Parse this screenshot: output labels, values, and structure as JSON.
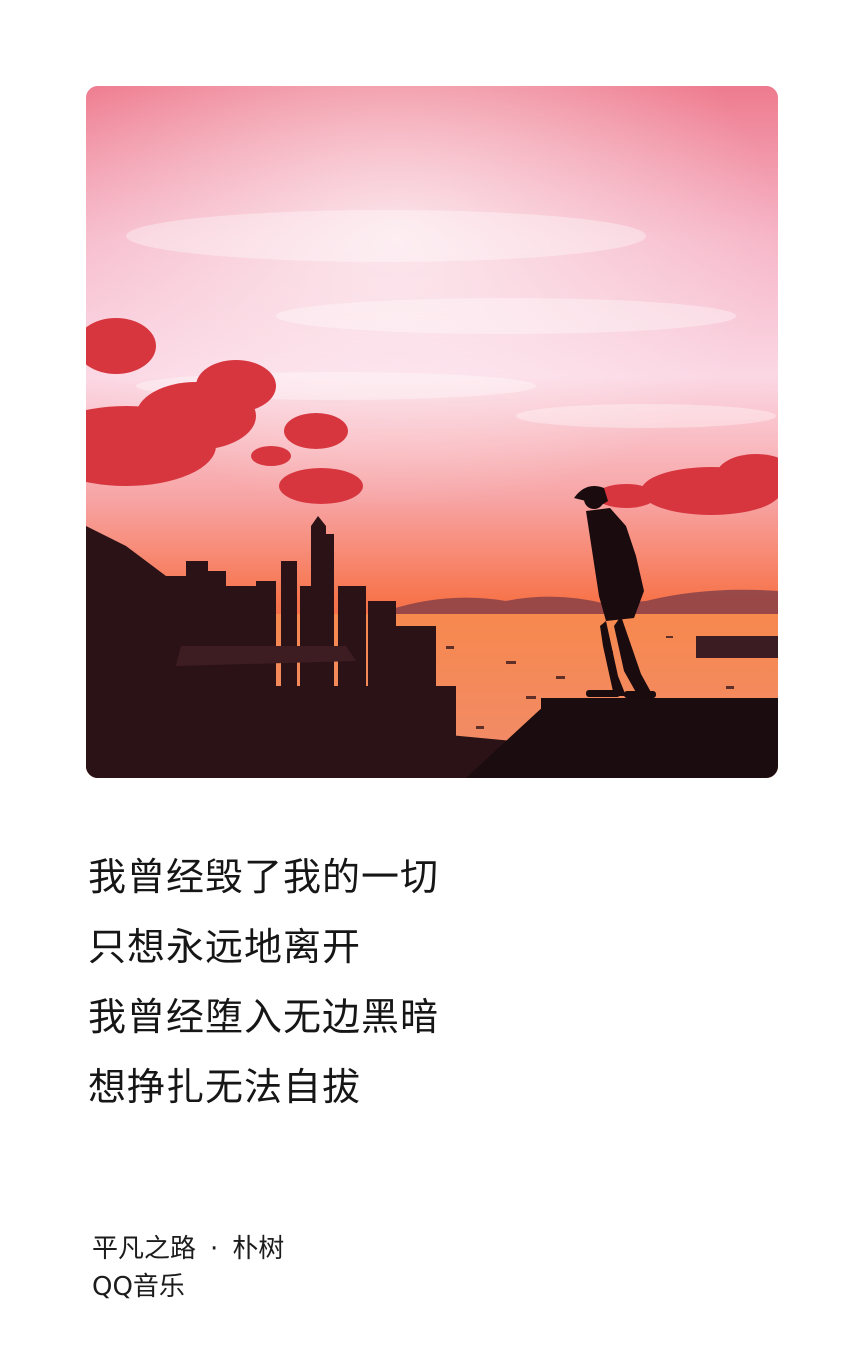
{
  "lyrics": [
    "我曾经毁了我的一切",
    "只想永远地离开",
    "我曾经堕入无边黑暗",
    "想挣扎无法自拔"
  ],
  "song": {
    "title": "平凡之路",
    "separator": "·",
    "artist": "朴树"
  },
  "source": "QQ音乐",
  "colors": {
    "sky_top": "#f07d8f",
    "sky_mid": "#f9cfe0",
    "horizon": "#f7724a",
    "water": "#f58a5a",
    "silhouette": "#1a0d10",
    "cloud": "#d83a45"
  }
}
